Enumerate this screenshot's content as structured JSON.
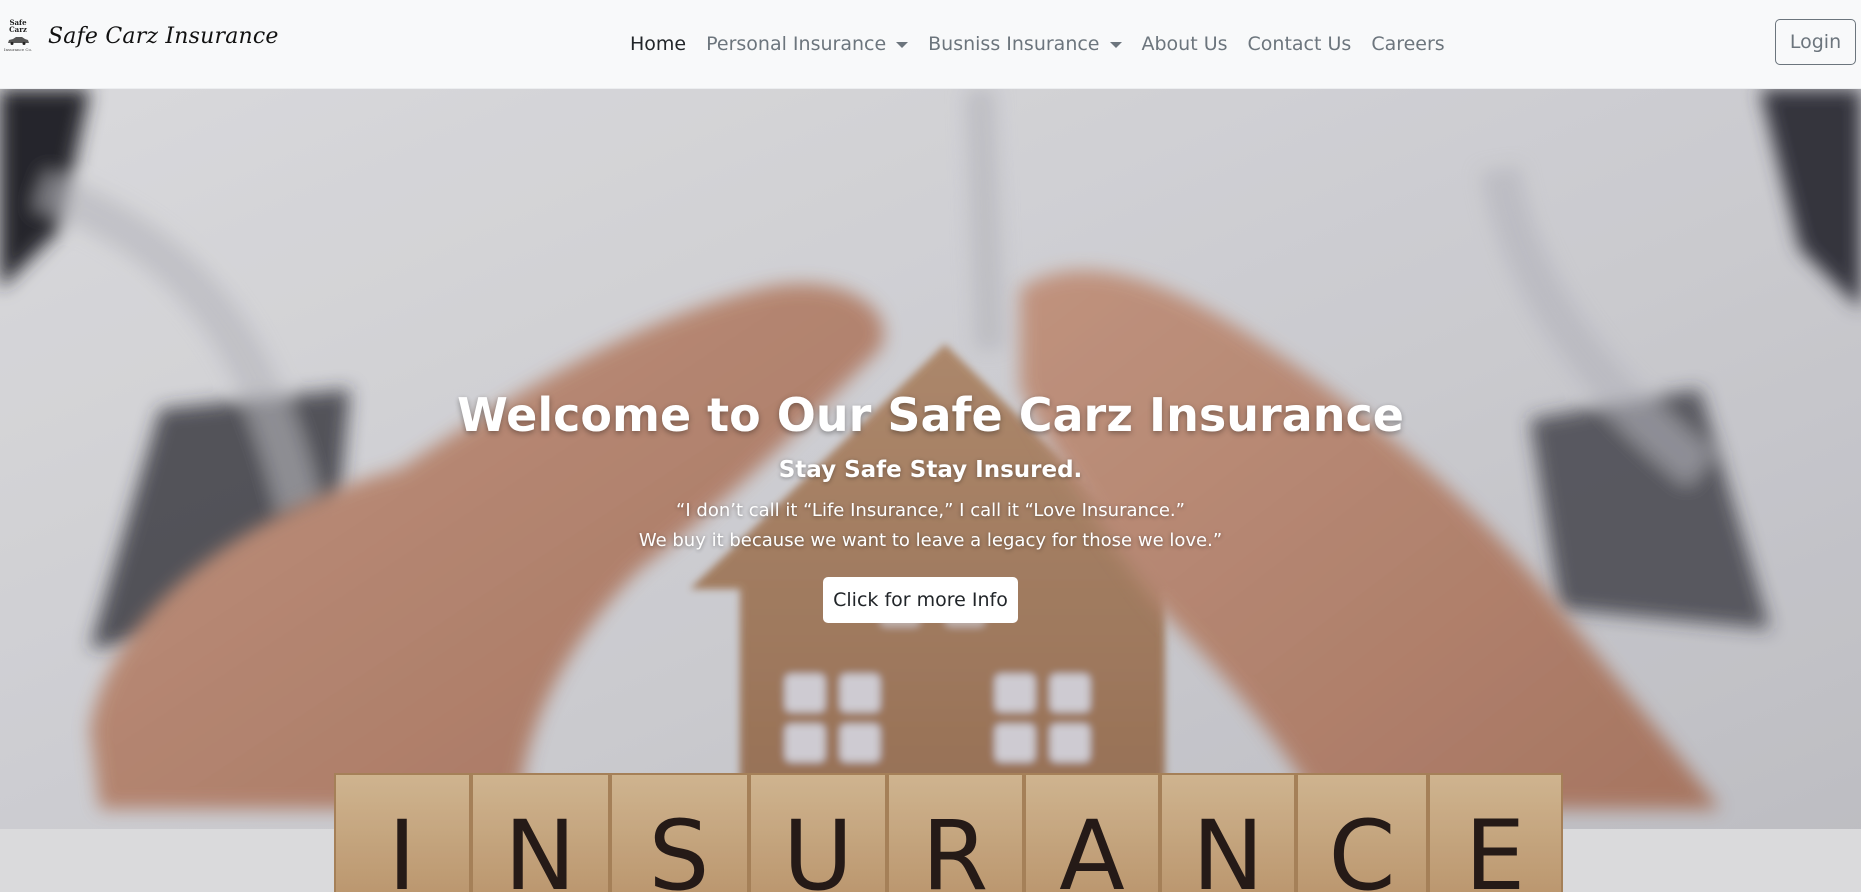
{
  "brand": {
    "logo_line1": "Safe",
    "logo_line2": "Carz",
    "logo_line3": "Insurance Co.",
    "name": "Safe Carz Insurance"
  },
  "nav": {
    "items": [
      {
        "label": "Home",
        "active": true,
        "dropdown": false
      },
      {
        "label": "Personal Insurance",
        "active": false,
        "dropdown": true
      },
      {
        "label": "Busniss Insurance",
        "active": false,
        "dropdown": true
      },
      {
        "label": "About Us",
        "active": false,
        "dropdown": false
      },
      {
        "label": "Contact Us",
        "active": false,
        "dropdown": false
      },
      {
        "label": "Careers",
        "active": false,
        "dropdown": false
      }
    ],
    "login_label": "Login"
  },
  "hero": {
    "title": "Welcome to Our Safe Carz Insurance",
    "subtitle": "Stay Safe Stay Insured.",
    "quote_line1": "“I don’t call it “Life Insurance,” I call it “Love Insurance.”",
    "quote_line2": "We buy it because we want to leave a legacy for those we love.”",
    "button_label": "Click for more Info",
    "tiles": [
      "I",
      "N",
      "S",
      "U",
      "R",
      "A",
      "N",
      "C",
      "E"
    ]
  },
  "colors": {
    "navbar_bg": "#f8f9fa",
    "nav_text": "#6c757d",
    "nav_active": "#212529",
    "hero_text": "#ffffff",
    "tile_wood": "#d8b58a",
    "tile_letter": "#2a1d1a"
  }
}
